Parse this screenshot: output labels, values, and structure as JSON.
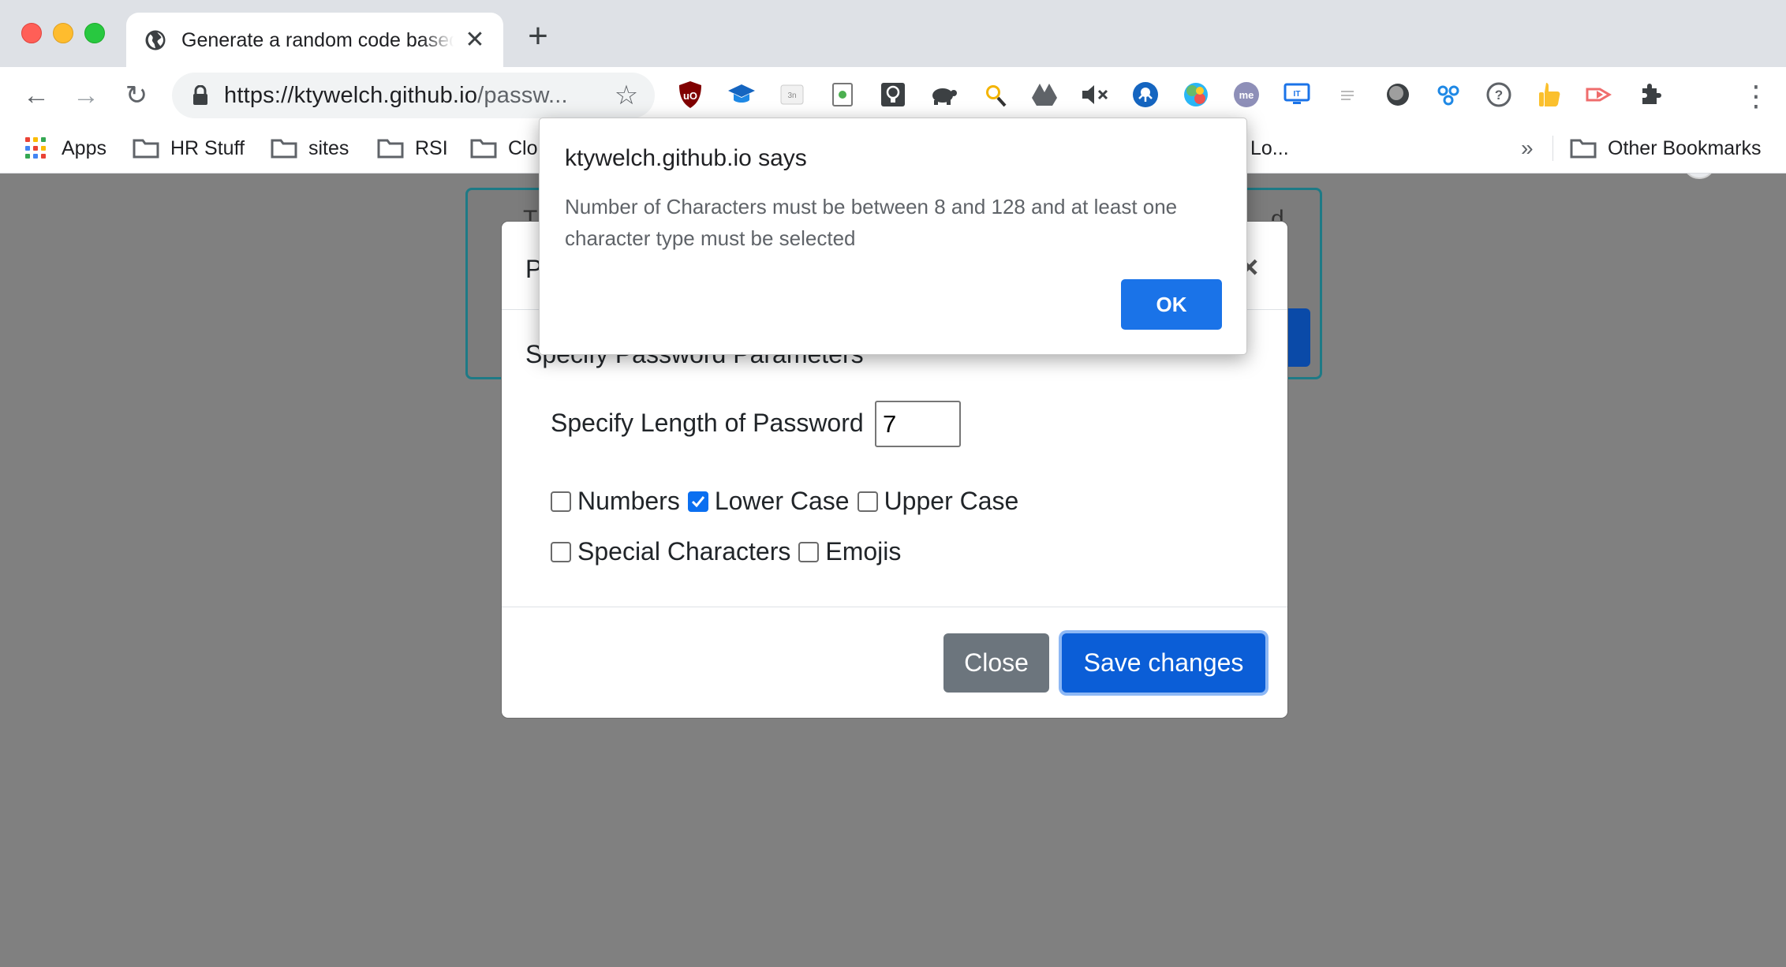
{
  "browser": {
    "tab_title": "Generate a random code based",
    "tab_close": "✕",
    "new_tab": "+",
    "url_host": "https://ktywelch.github.io",
    "url_path": "/passw...",
    "back": "←",
    "forward": "→",
    "reload": "↻",
    "star": "☆",
    "extension_badge": "!",
    "menu": "⋮"
  },
  "bookmarks": {
    "items": [
      "Apps",
      "HR Stuff",
      "sites",
      "RSI",
      "Clou",
      "Lo..."
    ],
    "overflow": "»",
    "other": "Other Bookmarks"
  },
  "page": {
    "card_text_left": "T",
    "card_text_right": "d"
  },
  "modal": {
    "title": "P",
    "close_x": "×",
    "body_title": "Specify Password Parameters",
    "length_label": "Specify Length of Password",
    "length_value": "7",
    "options": [
      {
        "label": "Numbers",
        "checked": false
      },
      {
        "label": "Lower Case",
        "checked": true
      },
      {
        "label": "Upper Case",
        "checked": false
      },
      {
        "label": "Special Characters",
        "checked": false
      },
      {
        "label": "Emojis",
        "checked": false
      }
    ],
    "close_button": "Close",
    "save_button": "Save changes"
  },
  "alert": {
    "title": "ktywelch.github.io says",
    "message": "Number of Characters must be between 8 and 128 and at least one character type must be selected",
    "ok_button": "OK"
  },
  "colors": {
    "primary": "#0b5ed7",
    "secondary": "#6c757d",
    "alert_ok": "#1a73e8",
    "overlay": "#808080"
  }
}
